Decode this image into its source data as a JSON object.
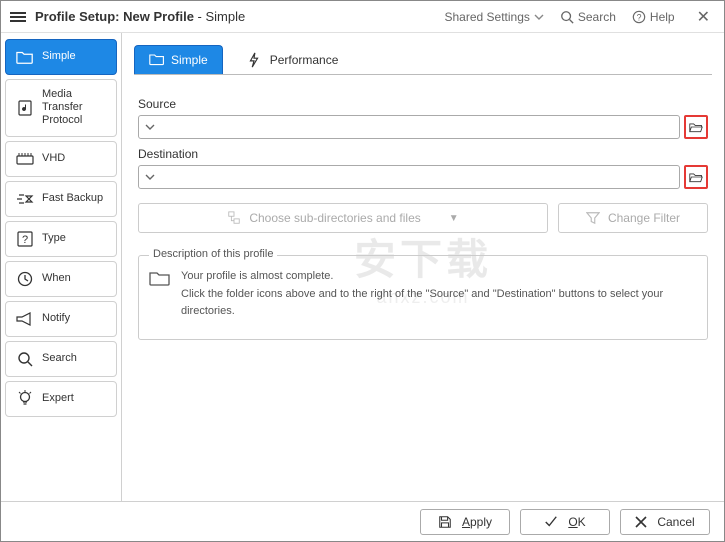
{
  "header": {
    "title_prefix": "Profile Setup: ",
    "title_name": "New Profile",
    "title_suffix": " - Simple",
    "shared_settings": "Shared Settings",
    "search": "Search",
    "help": "Help"
  },
  "sidebar": {
    "items": [
      {
        "label": "Simple"
      },
      {
        "label": "Media Transfer Protocol"
      },
      {
        "label": "VHD"
      },
      {
        "label": "Fast Backup"
      },
      {
        "label": "Type"
      },
      {
        "label": "When"
      },
      {
        "label": "Notify"
      },
      {
        "label": "Search"
      },
      {
        "label": "Expert"
      }
    ]
  },
  "tabs": {
    "simple": "Simple",
    "performance": "Performance"
  },
  "form": {
    "source_label": "Source",
    "source_value": "",
    "dest_label": "Destination",
    "dest_value": "",
    "choose_sub": "Choose sub-directories and files",
    "change_filter": "Change Filter"
  },
  "description": {
    "legend": "Description of this profile",
    "line1": "Your profile is almost complete.",
    "line2": "Click the folder icons above and to the right of the \"Source\" and \"Destination\" buttons to select your directories."
  },
  "footer": {
    "apply": "Apply",
    "ok": "OK",
    "cancel": "Cancel"
  },
  "watermark": {
    "cn": "安下载",
    "url": "anxz.com"
  }
}
